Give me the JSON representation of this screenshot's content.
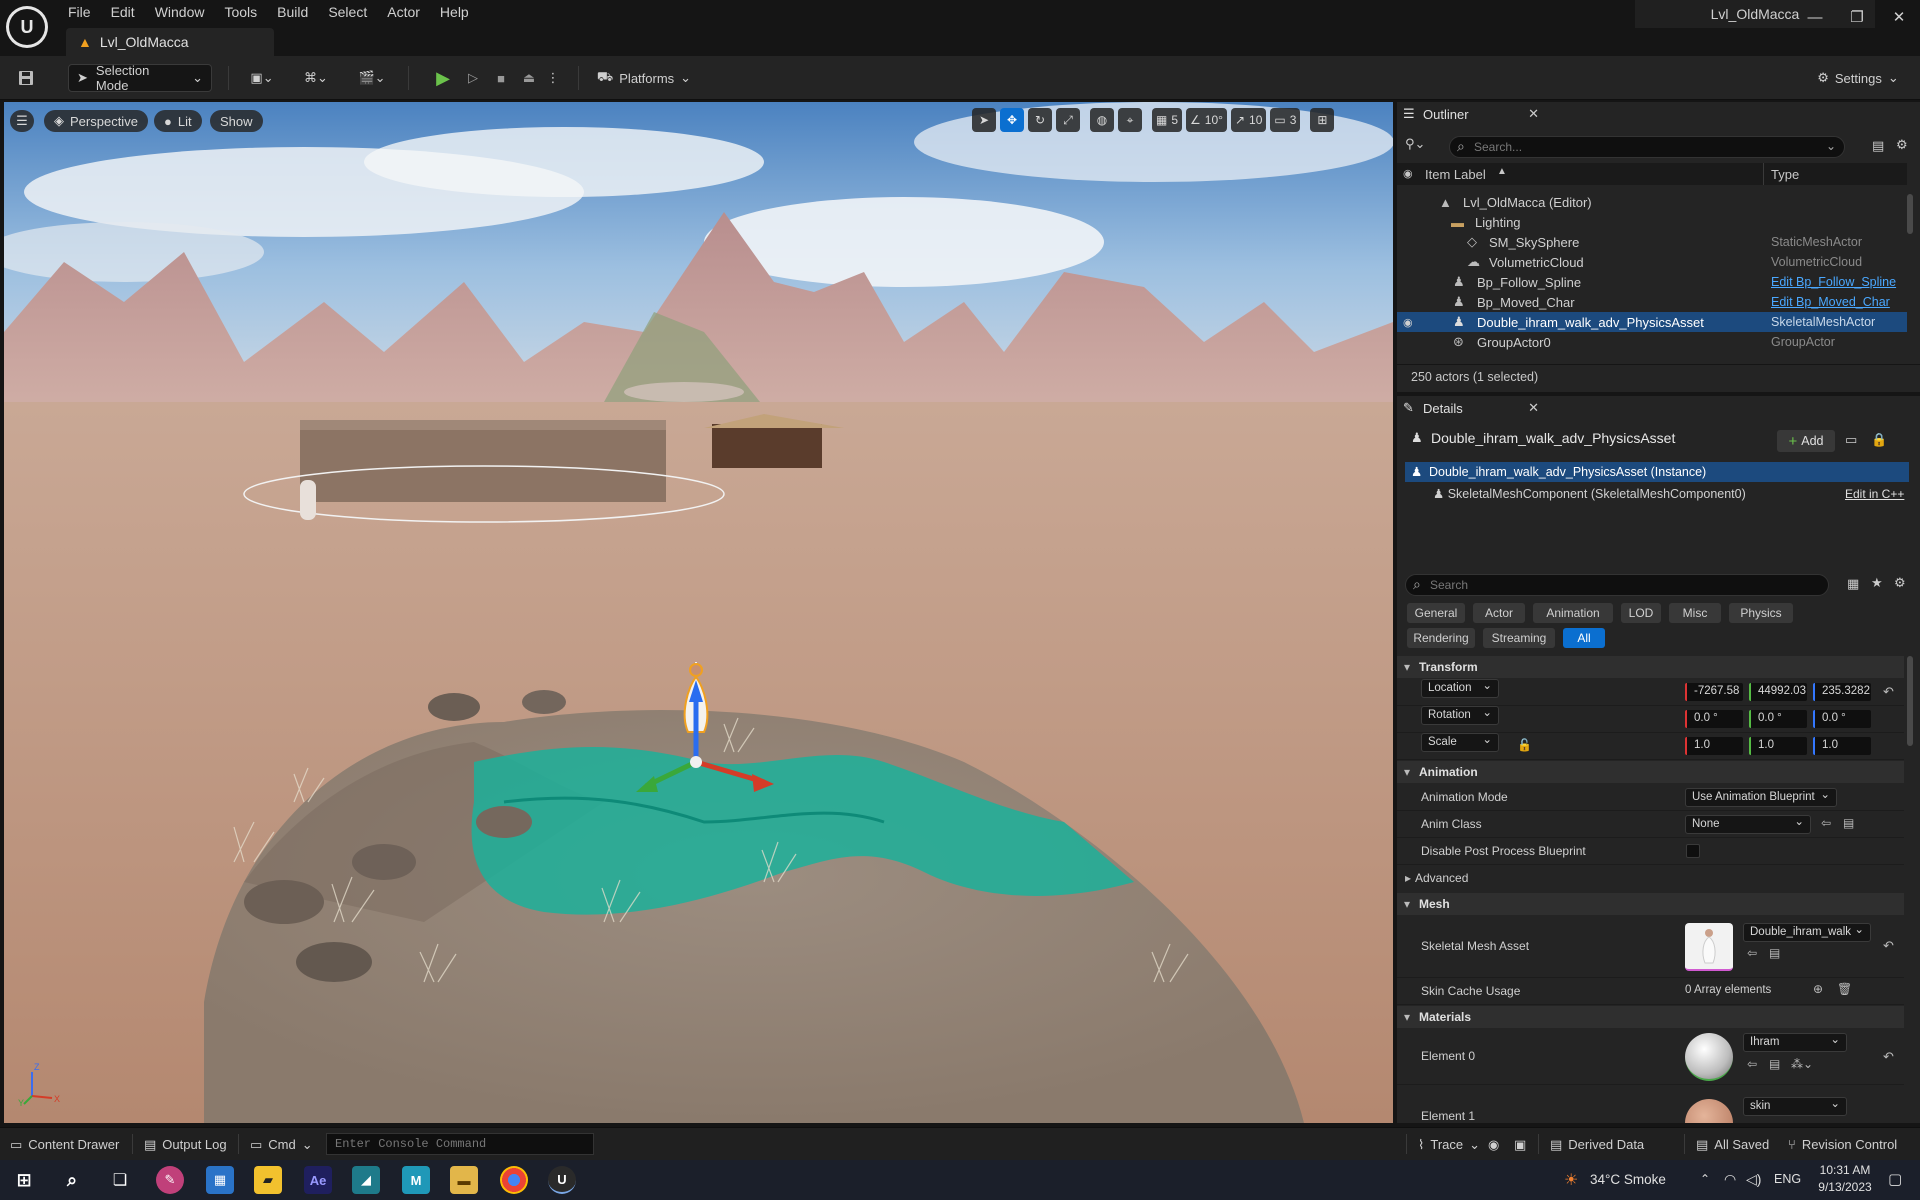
{
  "app": {
    "menu": [
      "File",
      "Edit",
      "Window",
      "Tools",
      "Build",
      "Select",
      "Actor",
      "Help"
    ],
    "window_title": "Lvl_OldMacca",
    "level_tab": "Lvl_OldMacca"
  },
  "toolbar": {
    "selection_mode": "Selection Mode",
    "platforms": "Platforms",
    "settings": "Settings"
  },
  "viewport": {
    "perspective": "Perspective",
    "lit": "Lit",
    "show": "Show",
    "grid_size": "5",
    "rotation_snap": "10°",
    "scale_snap": "10",
    "camera_speed": "3",
    "axis_labels": {
      "z": "Z",
      "y": "Y",
      "x": "X"
    }
  },
  "outliner": {
    "title": "Outliner",
    "search_placeholder": "Search...",
    "col_label": "Item Label",
    "col_type": "Type",
    "rows": [
      {
        "label": "Lvl_OldMacca (Editor)",
        "type": ""
      },
      {
        "label": "Lighting",
        "type": ""
      },
      {
        "label": "SM_SkySphere",
        "type": "StaticMeshActor"
      },
      {
        "label": "VolumetricCloud",
        "type": "VolumetricCloud"
      },
      {
        "label": "Bp_Follow_Spline",
        "type": "Edit Bp_Follow_Spline"
      },
      {
        "label": "Bp_Moved_Char",
        "type": "Edit Bp_Moved_Char"
      },
      {
        "label": "Double_ihram_walk_adv_PhysicsAsset",
        "type": "SkeletalMeshActor"
      },
      {
        "label": "GroupActor0",
        "type": "GroupActor"
      }
    ],
    "footer": "250 actors (1 selected)"
  },
  "details": {
    "title": "Details",
    "actor_name": "Double_ihram_walk_adv_PhysicsAsset",
    "add_label": "Add",
    "instance_label": "Double_ihram_walk_adv_PhysicsAsset (Instance)",
    "component_label": "SkeletalMeshComponent (SkeletalMeshComponent0)",
    "edit_cpp": "Edit in C++",
    "search_placeholder": "Search",
    "category_tabs": [
      "General",
      "Actor",
      "Animation",
      "LOD",
      "Misc",
      "Physics",
      "Rendering",
      "Streaming",
      "All"
    ],
    "active_tab": "All",
    "transform": {
      "header": "Transform",
      "location_label": "Location",
      "location": [
        "-7267.58",
        "44992.03",
        "235.3282"
      ],
      "rotation_label": "Rotation",
      "rotation": [
        "0.0 °",
        "0.0 °",
        "0.0 °"
      ],
      "scale_label": "Scale",
      "scale": [
        "1.0",
        "1.0",
        "1.0"
      ]
    },
    "animation": {
      "header": "Animation",
      "mode_label": "Animation Mode",
      "mode_value": "Use Animation Blueprint",
      "anim_class_label": "Anim Class",
      "anim_class_value": "None",
      "disable_pp_label": "Disable Post Process Blueprint"
    },
    "advanced_label": "Advanced",
    "mesh": {
      "header": "Mesh",
      "asset_label": "Skeletal Mesh Asset",
      "asset_value": "Double_ihram_walk",
      "skin_cache_label": "Skin Cache Usage",
      "skin_cache_value": "0 Array elements"
    },
    "materials": {
      "header": "Materials",
      "element0_label": "Element 0",
      "element0_value": "Ihram",
      "element1_label": "Element 1",
      "element1_value": "skin"
    }
  },
  "statusbar": {
    "content_drawer": "Content Drawer",
    "output_log": "Output Log",
    "cmd": "Cmd",
    "console_placeholder": "Enter Console Command",
    "trace": "Trace",
    "derived_data": "Derived Data",
    "all_saved": "All Saved",
    "revision_control": "Revision Control"
  },
  "taskbar": {
    "weather": "34°C  Smoke",
    "lang": "ENG",
    "time": "10:31 AM",
    "date": "9/13/2023"
  }
}
